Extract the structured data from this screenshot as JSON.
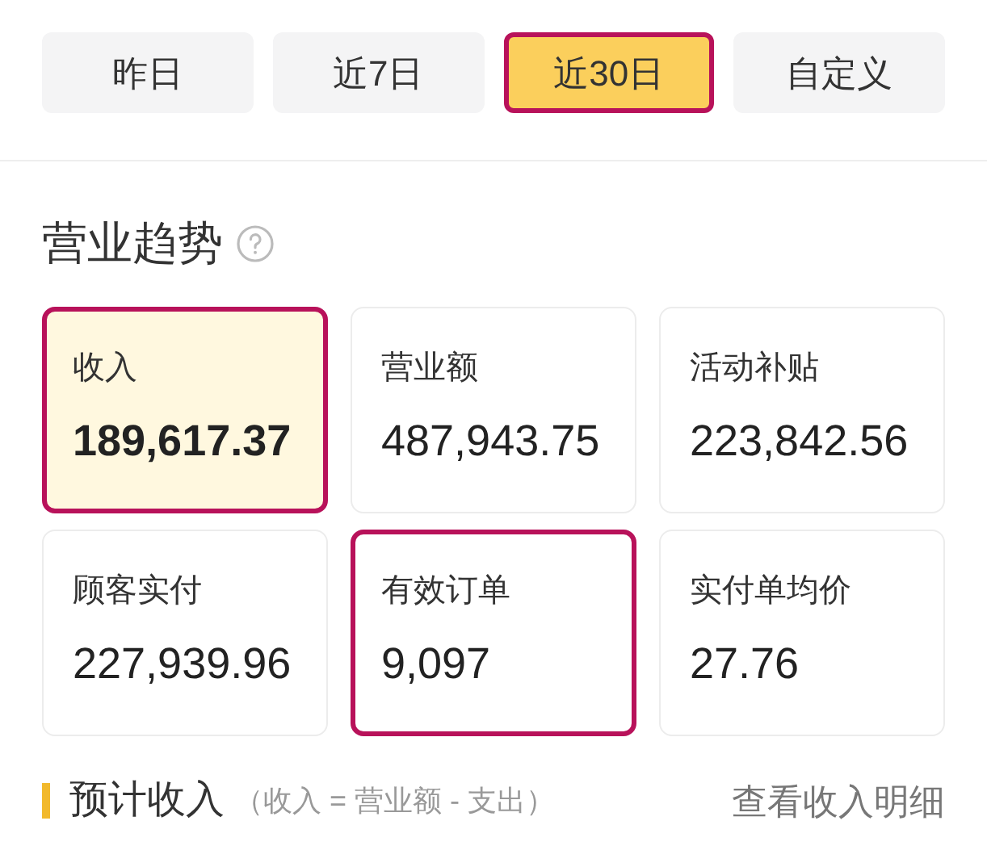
{
  "tabs": [
    {
      "label": "昨日",
      "selected": false,
      "highlighted": false
    },
    {
      "label": "近7日",
      "selected": false,
      "highlighted": false
    },
    {
      "label": "近30日",
      "selected": true,
      "highlighted": true
    },
    {
      "label": "自定义",
      "selected": false,
      "highlighted": false
    }
  ],
  "section": {
    "title": "营业趋势"
  },
  "metrics": [
    {
      "label": "收入",
      "value": "189,617.37",
      "selected": true,
      "highlighted": true
    },
    {
      "label": "营业额",
      "value": "487,943.75",
      "selected": false,
      "highlighted": false
    },
    {
      "label": "活动补贴",
      "value": "223,842.56",
      "selected": false,
      "highlighted": false
    },
    {
      "label": "顾客实付",
      "value": "227,939.96",
      "selected": false,
      "highlighted": false
    },
    {
      "label": "有效订单",
      "value": "9,097",
      "selected": false,
      "highlighted": true
    },
    {
      "label": "实付单均价",
      "value": "27.76",
      "selected": false,
      "highlighted": false
    }
  ],
  "footer": {
    "title": "预计收入",
    "note": "（收入 = 营业额 - 支出）",
    "link": "查看收入明细"
  }
}
